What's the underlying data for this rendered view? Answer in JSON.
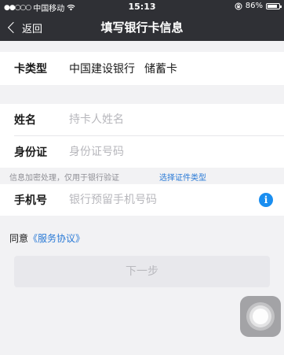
{
  "status_bar": {
    "carrier": "中国移动",
    "time": "15:13",
    "battery": "86%",
    "battery_level": 0.86,
    "signal_icon": "signal-dots-icon",
    "wifi_icon": "wifi-icon",
    "lock_icon": "orientation-lock-icon"
  },
  "nav": {
    "back_label": "返回",
    "title": "填写银行卡信息"
  },
  "card": {
    "type_label": "卡类型",
    "bank": "中国建设银行",
    "card_kind": "储蓄卡"
  },
  "identity": {
    "name_label": "姓名",
    "name_placeholder": "持卡人姓名",
    "id_label": "身份证",
    "id_placeholder": "身份证号码"
  },
  "hint": {
    "note": "信息加密处理，仅用于银行验证",
    "select_id_type": "选择证件类型"
  },
  "phone": {
    "label": "手机号",
    "placeholder": "银行预留手机号码",
    "info_icon": "i"
  },
  "agreement": {
    "prefix": "同意",
    "link": "《服务协议》"
  },
  "next_button": "下一步",
  "colors": {
    "nav_bg": "#2f3035",
    "link": "#2a7ad6",
    "info_icon": "#1a8ef0",
    "button_bg": "#e8e8ec"
  }
}
